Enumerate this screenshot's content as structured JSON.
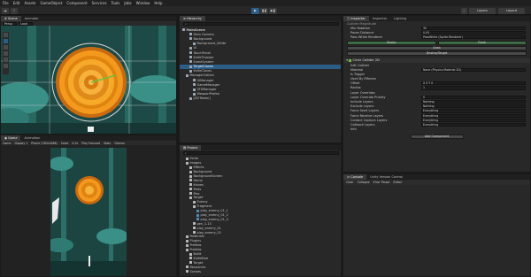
{
  "menu": [
    "File",
    "Edit",
    "Assets",
    "GameObject",
    "Component",
    "Services",
    "Tools",
    "Jobs",
    "Window",
    "Help"
  ],
  "toolbar": {
    "layers": "Layers",
    "layout": "Layout"
  },
  "scene_tabs": [
    "Scene",
    "Animator"
  ],
  "scene_tools": {
    "persp": "Persp",
    "local": "Local"
  },
  "game_tabs": [
    "Game",
    "Animation"
  ],
  "game_bar": {
    "game": "Game",
    "display": "Display 1",
    "res": "Phone (780x1688)",
    "scale_label": "Scale",
    "scale_value": "0.2x",
    "play": "Play Focused",
    "stats": "Stats",
    "gizmos": "Gizmos"
  },
  "hierarchy": {
    "title": "Hierarchy",
    "items": [
      {
        "label": "MainScene",
        "depth": 0,
        "bold": true,
        "selected": false
      },
      {
        "label": "Main Camera",
        "depth": 2,
        "selected": false
      },
      {
        "label": "Background",
        "depth": 2,
        "selected": false
      },
      {
        "label": "Background_White",
        "depth": 3,
        "selected": false
      },
      {
        "label": "UI",
        "depth": 2,
        "selected": false
      },
      {
        "label": "TouchPanel",
        "depth": 2,
        "selected": false
      },
      {
        "label": "KnifeThrower",
        "depth": 2,
        "selected": false
      },
      {
        "label": "EventSystem",
        "depth": 2,
        "selected": false
      },
      {
        "label": "TargetClones",
        "depth": 2,
        "selected": true
      },
      {
        "label": "KnifeClones",
        "depth": 2,
        "selected": false
      },
      {
        "label": "ManagerCollect",
        "depth": 1,
        "selected": false
      },
      {
        "label": "UIManager",
        "depth": 3,
        "selected": false
      },
      {
        "label": "GameManager",
        "depth": 3,
        "selected": false
      },
      {
        "label": "SFXManager",
        "depth": 3,
        "selected": false
      },
      {
        "label": "WeaponPrefab",
        "depth": 3,
        "selected": false
      },
      {
        "label": "[DOTween]",
        "depth": 2,
        "selected": false
      }
    ]
  },
  "project": {
    "title": "Project",
    "breadcrumb": "Assets > Fonts",
    "items": [
      {
        "label": "Fonts",
        "depth": 1
      },
      {
        "label": "Images",
        "depth": 1
      },
      {
        "label": "Effects",
        "depth": 2
      },
      {
        "label": "Background",
        "depth": 2
      },
      {
        "label": "BackgroundScreen",
        "depth": 2
      },
      {
        "label": "Home",
        "depth": 2
      },
      {
        "label": "Knives",
        "depth": 2
      },
      {
        "label": "Parts",
        "depth": 2
      },
      {
        "label": "Pies",
        "depth": 2
      },
      {
        "label": "Target",
        "depth": 2
      },
      {
        "label": "Enemy",
        "depth": 3
      },
      {
        "label": "Fragment",
        "depth": 3
      },
      {
        "label": "play_enemy_01_1",
        "depth": 4
      },
      {
        "label": "play_enemy_01_2",
        "depth": 4
      },
      {
        "label": "play_enemy_01_3",
        "depth": 4
      },
      {
        "label": "gen_1-13",
        "depth": 3
      },
      {
        "label": "play_enemy_01",
        "depth": 3
      },
      {
        "label": "play_enemy_02",
        "depth": 3
      },
      {
        "label": "Materials",
        "depth": 1
      },
      {
        "label": "Plugins",
        "depth": 1
      },
      {
        "label": "Prefabs",
        "depth": 1
      },
      {
        "label": "Prefabs",
        "depth": 1
      },
      {
        "label": "Bullit",
        "depth": 2
      },
      {
        "label": "KnifeBlue",
        "depth": 2
      },
      {
        "label": "Target",
        "depth": 2
      },
      {
        "label": "Resources",
        "depth": 1
      },
      {
        "label": "Scenes",
        "depth": 1
      }
    ]
  },
  "inspector": {
    "tabs": [
      "Inspector",
      "Inspector",
      "Lighting"
    ],
    "header": "Collider Magnitude",
    "top_fields": [
      {
        "label": "Min Rotation",
        "value": "30"
      },
      {
        "label": "Paces Distance",
        "value": "0.05"
      },
      {
        "label": "Pass White Renderer",
        "value": "PassWhite (Sprite Renderer)"
      }
    ],
    "buttons": {
      "shake": "Shake",
      "flash": "Flash",
      "grab": "Grab",
      "destroy": "DestroyTarget",
      "add": "Add Component"
    },
    "circle_title": "Circle Collider 2D",
    "circle_fields": [
      {
        "label": "Edit Collider",
        "value": ""
      },
      {
        "label": "Material",
        "value": "None (Physics Material 2D)"
      },
      {
        "label": "Is Trigger",
        "value": ""
      },
      {
        "label": "Used By Effector",
        "value": ""
      },
      {
        "label": "Offset",
        "value": "X 0      Y 0"
      },
      {
        "label": "Radius",
        "value": "1"
      },
      {
        "label": "Layer Overrides",
        "value": ""
      },
      {
        "label": "Layer Override Priority",
        "value": "0"
      },
      {
        "label": "Include Layers",
        "value": "Nothing"
      },
      {
        "label": "Exclude Layers",
        "value": "Nothing"
      },
      {
        "label": "Force Send Layers",
        "value": "Everything"
      },
      {
        "label": "Force Receive Layers",
        "value": "Everything"
      },
      {
        "label": "Contact Capture Layers",
        "value": "Everything"
      },
      {
        "label": "Callback Layers",
        "value": "Everything"
      },
      {
        "label": "Info",
        "value": ""
      }
    ]
  },
  "console": {
    "tabs": [
      "Console",
      "Unity Version Control"
    ],
    "bar": [
      "Clear",
      "Collapse",
      "Error Pause",
      "Editor"
    ]
  },
  "colors": {
    "accent": "#2c5d87",
    "wood": "#e08a1a",
    "scene_bg": "#1b3d3a",
    "leaf": "#3a8f86"
  }
}
